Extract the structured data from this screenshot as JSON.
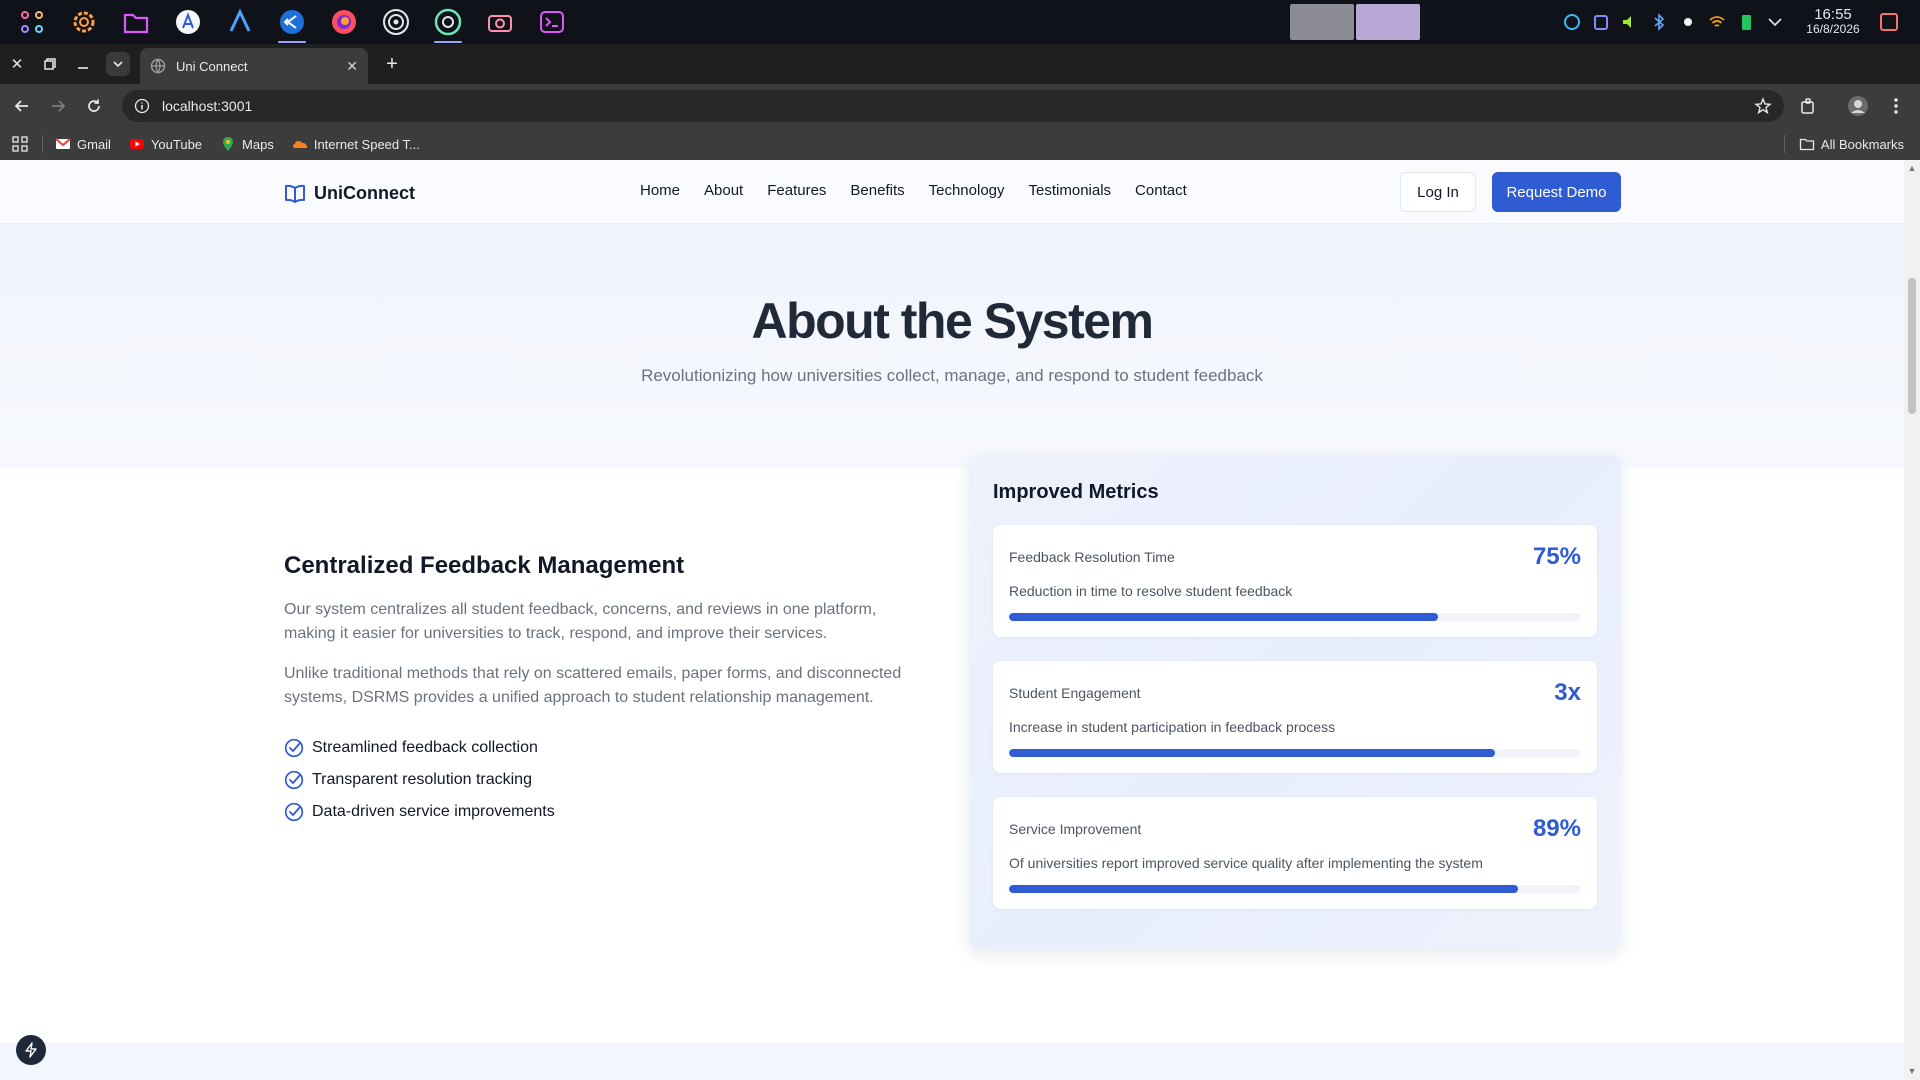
{
  "os": {
    "taskbar_apps": [
      "app-launcher",
      "settings",
      "files",
      "app-store",
      "editor",
      "vscode",
      "firefox",
      "obs",
      "chrome",
      "camera",
      "terminal"
    ],
    "clock_time": "16:55",
    "clock_date": "16/8/2026"
  },
  "browser": {
    "tab_title": "Uni Connect",
    "url": "localhost:3001",
    "bookmarks": [
      "Gmail",
      "YouTube",
      "Maps",
      "Internet Speed T..."
    ],
    "all_bookmarks": "All Bookmarks"
  },
  "site": {
    "brand": "UniConnect",
    "nav": [
      "Home",
      "About",
      "Features",
      "Benefits",
      "Technology",
      "Testimonials",
      "Contact"
    ],
    "login": "Log In",
    "request_demo": "Request Demo",
    "hero_title": "About the System",
    "hero_subtitle": "Revolutionizing how universities collect, manage, and respond to student feedback",
    "section_title": "Centralized Feedback Management",
    "para1": "Our system centralizes all student feedback, concerns, and reviews in one platform, making it easier for universities to track, respond, and improve their services.",
    "para2": "Unlike traditional methods that rely on scattered emails, paper forms, and disconnected systems, DSRMS provides a unified approach to student relationship management.",
    "checks": [
      "Streamlined feedback collection",
      "Transparent resolution tracking",
      "Data-driven service improvements"
    ],
    "metrics_title": "Improved Metrics",
    "metrics": [
      {
        "name": "Feedback Resolution Time",
        "value": "75%",
        "desc": "Reduction in time to resolve student feedback",
        "progress": 0.75
      },
      {
        "name": "Student Engagement",
        "value": "3x",
        "desc": "Increase in student participation in feedback process",
        "progress": 0.85
      },
      {
        "name": "Service Improvement",
        "value": "89%",
        "desc": "Of universities report improved service quality after implementing the system",
        "progress": 0.89
      }
    ]
  },
  "colors": {
    "accent": "#2f5bd3",
    "taskbar": "#0f1219",
    "chrome_dark": "#3c3c3c"
  }
}
